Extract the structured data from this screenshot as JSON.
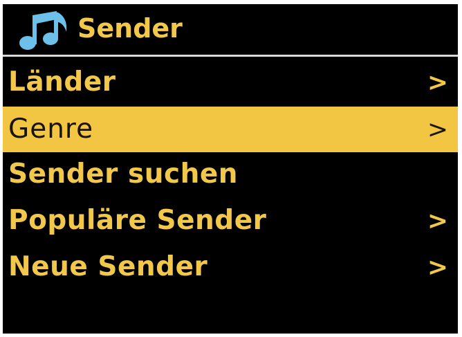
{
  "header": {
    "title": "Sender",
    "icon": "music-note-icon"
  },
  "menu": {
    "items": [
      {
        "label": "Länder",
        "chevron": ">",
        "selected": false
      },
      {
        "label": "Genre",
        "chevron": ">",
        "selected": true
      },
      {
        "label": "Sender suchen",
        "chevron": "",
        "selected": false
      },
      {
        "label": "Populäre Sender",
        "chevron": ">",
        "selected": false
      },
      {
        "label": "Neue Sender",
        "chevron": ">",
        "selected": false
      }
    ]
  },
  "colors": {
    "background": "#000000",
    "text": "#f2c84b",
    "selected_background": "#f2c542",
    "selected_text": "#1a1400",
    "icon": "#6cc0ea",
    "divider": "#d8d8d8"
  }
}
